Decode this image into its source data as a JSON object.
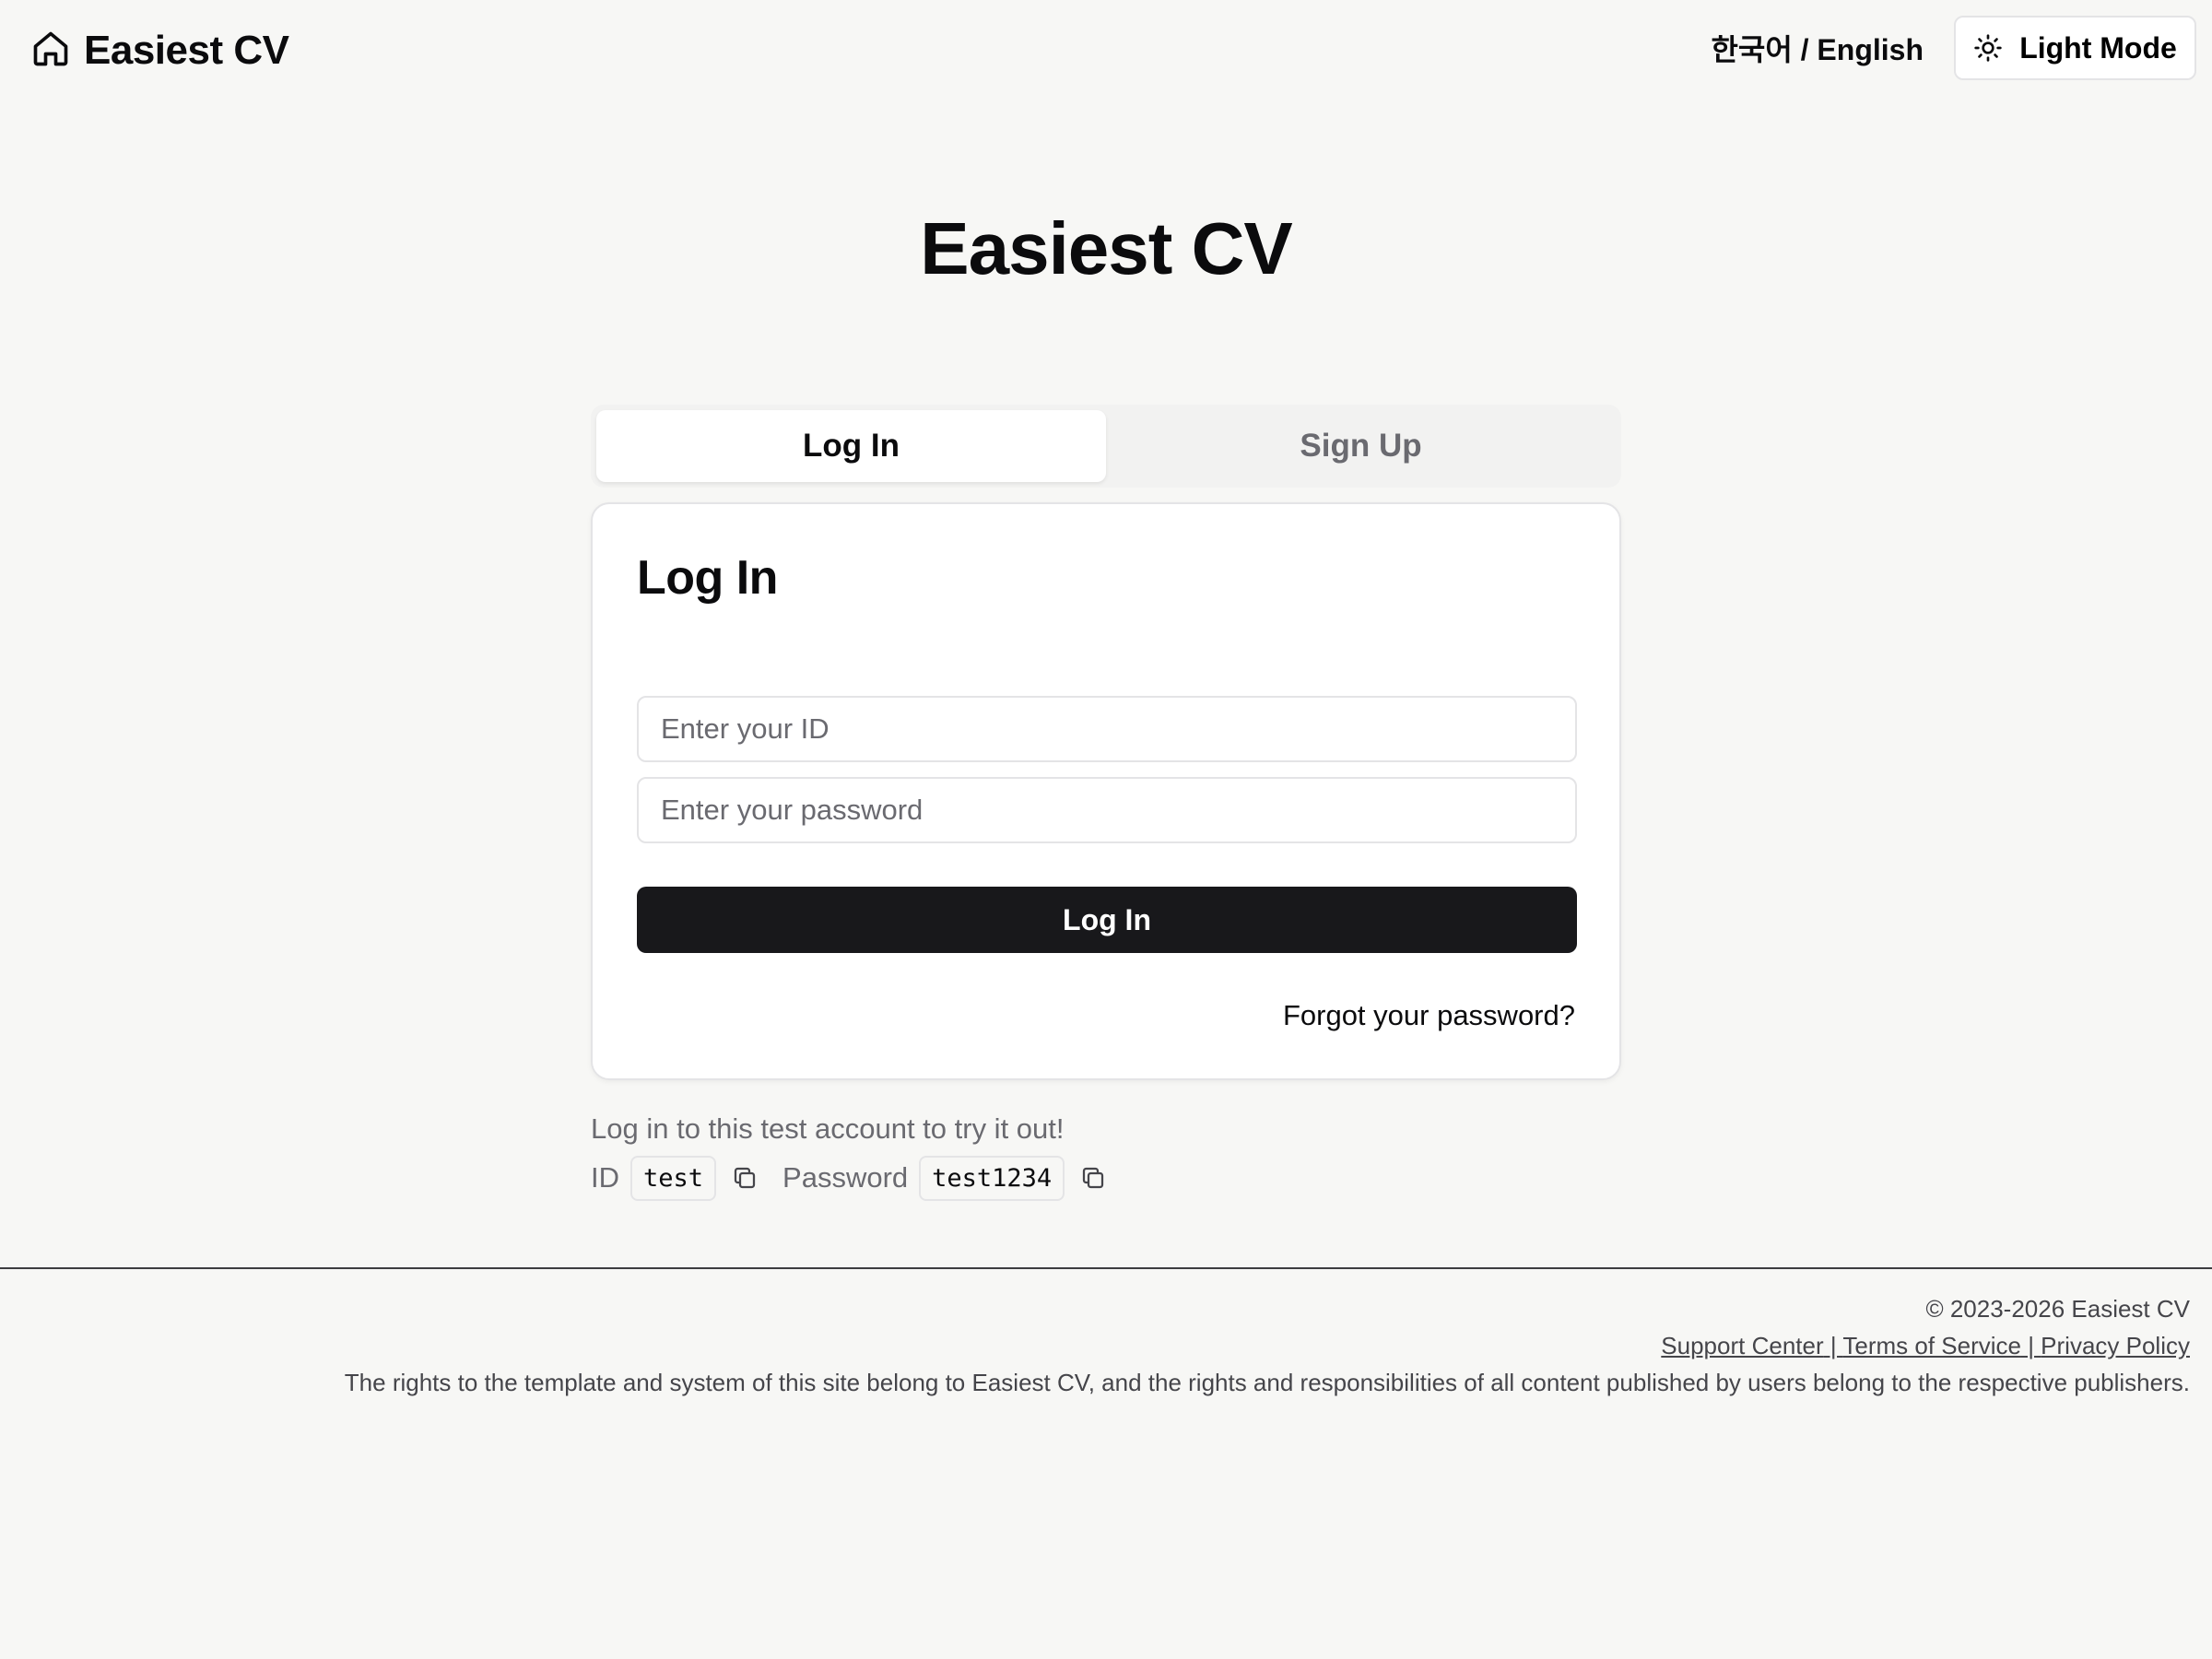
{
  "header": {
    "brand": "Easiest CV",
    "brand_icon": "home-icon",
    "language_switch": "한국어 / English",
    "theme_toggle_label": "Light Mode",
    "theme_icon": "sun-icon"
  },
  "main": {
    "title": "Easiest CV",
    "tabs": [
      {
        "label": "Log In",
        "active": true
      },
      {
        "label": "Sign Up",
        "active": false
      }
    ],
    "card": {
      "title": "Log In",
      "id_placeholder": "Enter your ID",
      "password_placeholder": "Enter your password",
      "submit_label": "Log In",
      "forgot_link": "Forgot your password?"
    },
    "test_account": {
      "note": "Log in to this test account to try it out!",
      "id_label": "ID",
      "id_value": "test",
      "password_label": "Password",
      "password_value": "test1234",
      "copy_icon": "copy-icon"
    }
  },
  "footer": {
    "copyright": "© 2023-2026 Easiest CV",
    "links": [
      "Support Center",
      "Terms of Service",
      "Privacy Policy"
    ],
    "separator": " | ",
    "disclaimer": "The rights to the template and system of this site belong to Easiest CV, and the rights and responsibilities of all content published by users belong to the respective publishers."
  },
  "colors": {
    "background": "#f7f7f5",
    "primary_button": "#18181b",
    "border": "#e4e4e6",
    "muted_text": "#6a6a70"
  }
}
